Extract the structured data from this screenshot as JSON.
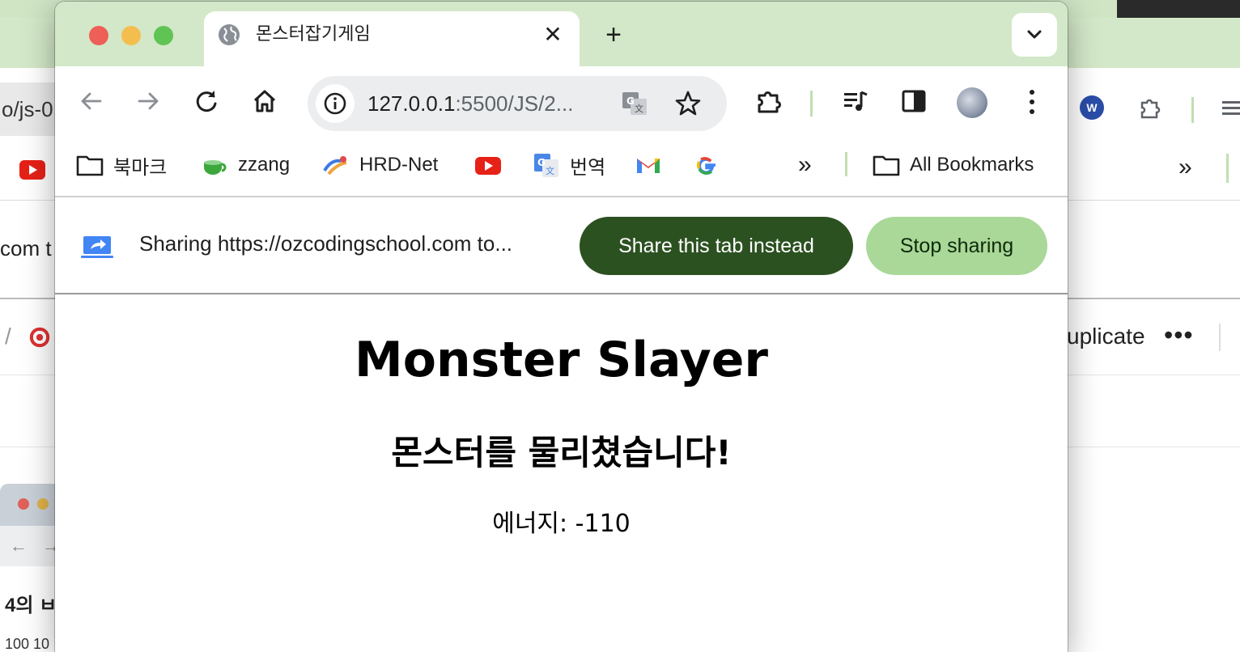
{
  "browser": {
    "tab": {
      "title": "몬스터잡기게임"
    },
    "address": {
      "host": "127.0.0.1",
      "path": ":5500/JS/2..."
    },
    "bookmarks": [
      {
        "label": "북마크",
        "icon": "folder-icon"
      },
      {
        "label": "zzang",
        "icon": "teacup-icon"
      },
      {
        "label": "HRD-Net",
        "icon": "hrdnet-icon"
      },
      {
        "label": "",
        "icon": "youtube-icon"
      },
      {
        "label": "번역",
        "icon": "google-translate-icon"
      },
      {
        "label": "",
        "icon": "gmail-icon"
      },
      {
        "label": "",
        "icon": "google-icon"
      }
    ],
    "all_bookmarks_label": "All Bookmarks",
    "share_bar": {
      "text": "Sharing https://ozcodingschool.com to...",
      "share_tab_label": "Share this tab instead",
      "stop_label": "Stop sharing"
    }
  },
  "page": {
    "title": "Monster Slayer",
    "result": "몬스터를 물리쳤습니다!",
    "energy": "에너지: -110"
  },
  "background": {
    "url_fragment": "o/js-0",
    "share_fragment": "com t",
    "duplicate_fragment": "uplicate",
    "mini_window_title": "4의 ㅂ",
    "mini_window_numbers": "100 10"
  },
  "colors": {
    "tabstrip": "#d3e8c8",
    "share_button": "#2c5121",
    "stop_button": "#a9d898",
    "divider": "#bfe0b0"
  }
}
